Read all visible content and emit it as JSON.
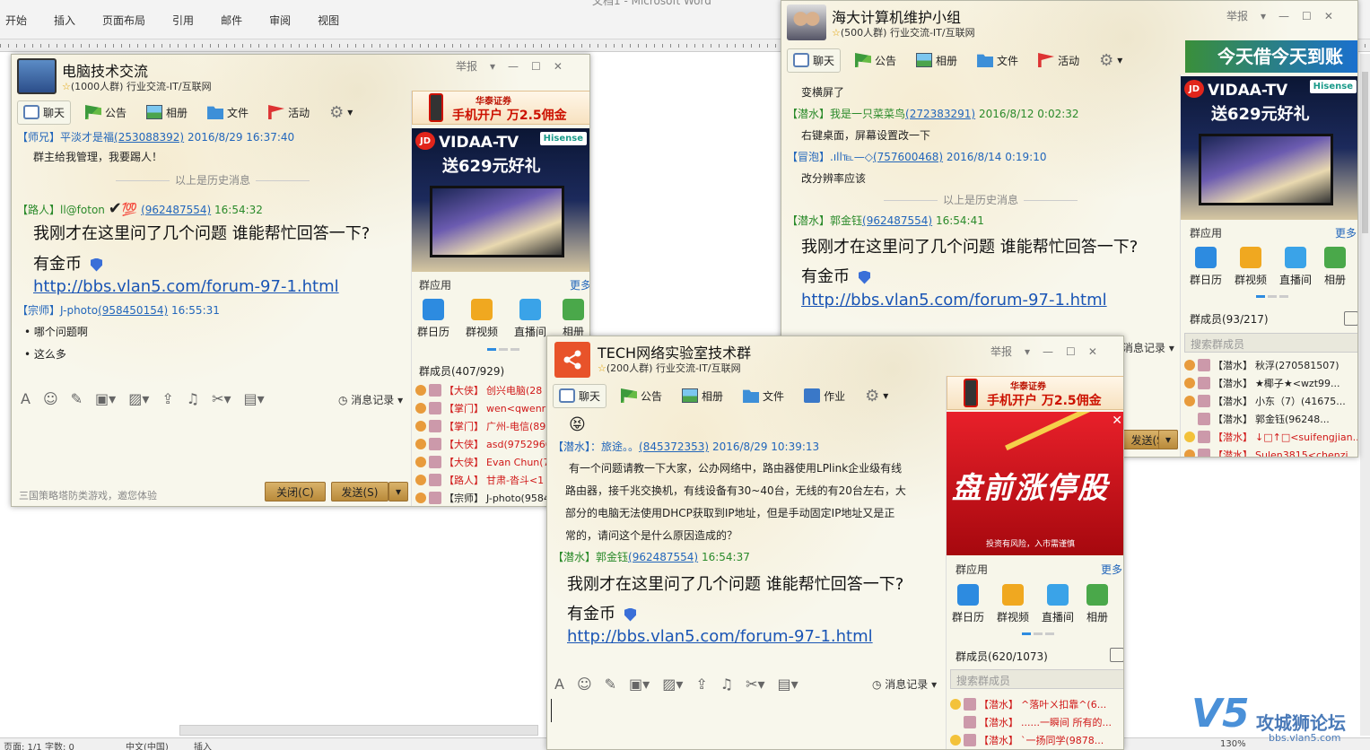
{
  "word": {
    "title": "文档1 - Microsoft Word",
    "tabs": [
      "开始",
      "插入",
      "页面布局",
      "引用",
      "邮件",
      "审阅",
      "视图"
    ],
    "status": {
      "page": "页面: 1/1",
      "words": "字数: 0",
      "lang": "中文(中国)",
      "mode": "插入",
      "zoom": "130%"
    }
  },
  "common": {
    "report": "举报",
    "tab_chat": "聊天",
    "tab_announce": "公告",
    "tab_album": "相册",
    "tab_file": "文件",
    "tab_activity": "活动",
    "tab_homework": "作业",
    "history": "以上是历史消息",
    "msg_record": "消息记录",
    "apps_title": "群应用",
    "more": "更多",
    "app_calendar": "群日历",
    "app_video": "群视频",
    "app_live": "直播间",
    "app_album": "相册",
    "search_placeholder": "搜索群成员",
    "close_btn": "关闭(C)",
    "send_btn": "发送(S)",
    "ad_broker": "华泰证券",
    "ad_broker_slogan": "手机开户 万2.5佣金",
    "ad_tv_l1": "VIDAA-TV",
    "ad_tv_l2": "送629元好礼",
    "ad_jd": "JD",
    "ad_hisense": "Hisense",
    "ad_stock": "盘前涨停股",
    "ad_stock_sub": "投资有风险，入市需谨慎",
    "ad_loan": "今天借今天到账",
    "question": "我刚才在这里问了几个问题 谁能帮忙回答一下?",
    "gold": "有金币",
    "link": "http://bbs.vlan5.com/forum-97-1.html"
  },
  "win1": {
    "name": "电脑技术交流",
    "info": "(1000人群) 行业交流-IT/互联网",
    "members_title": "群成员(407/929)",
    "hint": "三国策略塔防类游戏，邀您体验",
    "msgs": [
      {
        "role": "【师兄】",
        "nick": "平淡才是福",
        "qid": "(253088392)",
        "time": "2016/8/29 16:37:40",
        "text": "群主给我管理，我要踢人！"
      },
      {
        "role": "【路人】",
        "nick": "ll@foton",
        "qid": "(962487554)",
        "time": "16:54:32"
      },
      {
        "role": "【宗师】",
        "nick": "J-photo",
        "qid": "(958450154)",
        "time": "16:55:31",
        "text1": "哪个问题啊",
        "text2": "这么多"
      }
    ],
    "members": [
      {
        "role": "【大侠】",
        "name": "创兴电脑(28"
      },
      {
        "role": "【掌门】",
        "name": " wen<qwenr"
      },
      {
        "role": "【掌门】",
        "name": "广州-电信(89"
      },
      {
        "role": "【大侠】",
        "name": "asd(97529669"
      },
      {
        "role": "【大侠】",
        "name": "Evan Chun(78"
      },
      {
        "role": "【路人】",
        "name": "甘肃-沓斗<1"
      },
      {
        "role": "【宗师】",
        "name": "J-photo(9584"
      }
    ]
  },
  "win2": {
    "name": "海大计算机维护小组",
    "info": "(500人群) 行业交流-IT/互联网",
    "members_title": "群成员(93/217)",
    "msgs": [
      {
        "text": "变横屏了"
      },
      {
        "role": "【潜水】",
        "nick": "我是一只菜菜鸟",
        "qid": "(272383291)",
        "time": "2016/8/12 0:02:32",
        "text": "右键桌面，屏幕设置改一下"
      },
      {
        "role": "【冒泡】",
        "nick": ".ıll℡—◇",
        "qid": "(757600468)",
        "time": "2016/8/14 0:19:10",
        "text": "改分辨率应该"
      },
      {
        "role": "【潜水】",
        "nick": "郭金钰",
        "qid": "(962487554)",
        "time": "16:54:41"
      }
    ],
    "members": [
      {
        "role": "【潜水】",
        "name": "秋浮(270581507)"
      },
      {
        "role": "【潜水】",
        "name": "★椰子★<wzt99..."
      },
      {
        "role": "【潜水】",
        "name": "小东（7）(41675..."
      },
      {
        "role": "【潜水】",
        "name": "郭金钰(96248..."
      },
      {
        "role": "【潜水】",
        "name": "↓□↑□<suifengjian..."
      },
      {
        "role": "【潜水】",
        "name": "Sulen3815<chenzi..."
      }
    ]
  },
  "win3": {
    "name": "TECH网络实验室技术群",
    "info": "(200人群) 行业交流-IT/互联网",
    "members_title": "群成员(620/1073)",
    "msgs": [
      {
        "role": "【潜水】",
        "nick": "：旅途。。",
        "qid": "(845372353)",
        "time": "2016/8/29 10:39:13",
        "t1": "有一个问题请教一下大家，公办网络中，路由器使用LPlink企业级有线",
        "t2": "路由器，接千兆交换机，有线设备有30~40台，无线的有20台左右，大",
        "t3": "部分的电脑无法使用DHCP获取到IP地址，但是手动固定IP地址又是正",
        "t4": "常的，请问这个是什么原因造成的？"
      },
      {
        "role": "【潜水】",
        "nick": "郭金钰",
        "qid": "(962487554)",
        "time": "16:54:37"
      }
    ],
    "members": [
      {
        "role": "【潜水】",
        "name": "^落叶ㄨ扣靠^(6..."
      },
      {
        "role": "【潜水】",
        "name": "......一瞬间 所有的..."
      },
      {
        "role": "【潜水】",
        "name": "`一扬同学(9878..."
      }
    ]
  },
  "watermark": {
    "brand": "V5",
    "title": "攻城狮论坛",
    "url": "bbs.vlan5.com"
  }
}
